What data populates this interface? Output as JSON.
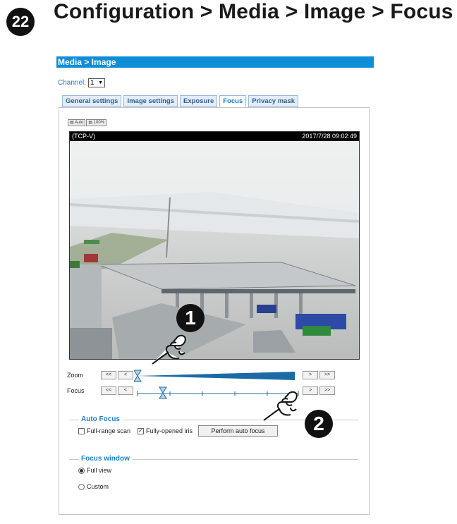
{
  "step_number": "22",
  "heading": "Configuration > Media > Image > Focus",
  "media_bar": "Media > Image",
  "channel": {
    "label": "Channel:",
    "value": "1"
  },
  "tabs": [
    {
      "label": "General settings",
      "active": false
    },
    {
      "label": "Image settings",
      "active": false
    },
    {
      "label": "Exposure",
      "active": false
    },
    {
      "label": "Focus",
      "active": true
    },
    {
      "label": "Privacy mask",
      "active": false
    }
  ],
  "view_buttons": {
    "auto": "Auto",
    "full": "100%"
  },
  "video": {
    "left_label": "(TCP-V)",
    "timestamp": "2017/7/28 09:02:49"
  },
  "zoom": {
    "label": "Zoom",
    "level": 0.0
  },
  "focus": {
    "label": "Focus",
    "level": 0.15
  },
  "step_buttons": {
    "far_back": "<<",
    "back": "<",
    "fwd": ">",
    "far_fwd": ">>"
  },
  "auto_focus": {
    "title": "Auto Focus",
    "full_range": {
      "label": "Full-range scan",
      "checked": false
    },
    "fully_opened": {
      "label": "Fully-opened iris",
      "checked": true
    },
    "button": "Perform auto focus"
  },
  "focus_window": {
    "title": "Focus window",
    "full_view": {
      "label": "Full view",
      "selected": true
    },
    "custom": {
      "label": "Custom",
      "selected": false
    }
  },
  "callouts": {
    "one": "1",
    "two": "2"
  },
  "colors": {
    "accent": "#0f8ed8",
    "slider": "#1b6aa5",
    "link": "#1e7fc8"
  }
}
